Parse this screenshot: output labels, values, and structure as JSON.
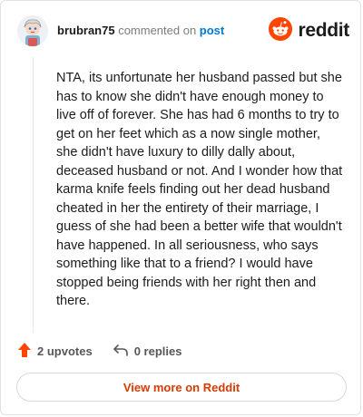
{
  "header": {
    "username": "brubran75",
    "action_text": " commented on ",
    "link_text": "post",
    "brand_text": "reddit"
  },
  "comment": {
    "body": "NTA, its unfortunate her husband passed but she has to know she didn't have enough money to live off of forever. She has had 6 months to try to get on her feet which as a now single mother, she didn't have luxury to dilly dally about, deceased husband or not. And I wonder how that karma knife feels finding out her dead husband cheated in her the entirety of their marriage, I guess of she had been a better wife that wouldn't have happened. In all seriousness, who says something like that to a friend? I would have stopped being friends with her right then and there."
  },
  "actions": {
    "upvotes": "2 upvotes",
    "replies": "0 replies"
  },
  "footer": {
    "view_more": "View more on Reddit"
  },
  "colors": {
    "brand_orange": "#ff4500",
    "link_blue": "#0079d3",
    "cta_text": "#d93a00"
  },
  "icons": [
    "avatar",
    "reddit-logo-icon",
    "upvote-arrow-icon",
    "reply-arrow-icon"
  ]
}
